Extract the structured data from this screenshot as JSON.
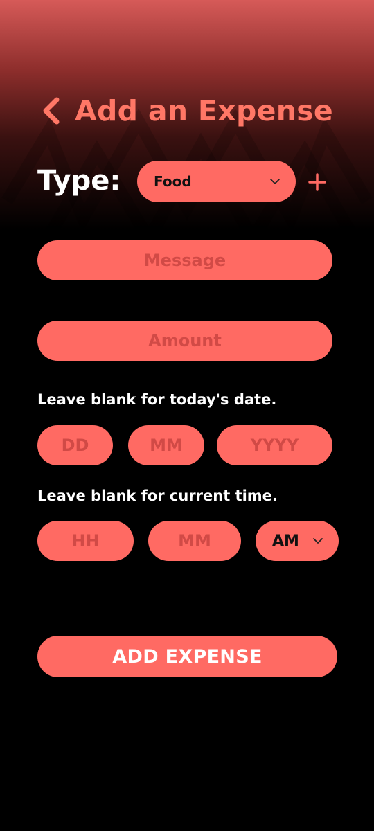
{
  "header": {
    "title": "Add an Expense",
    "back_icon": "chevron-left-icon"
  },
  "type_row": {
    "label": "Type:",
    "selected": "Food",
    "dropdown_icon": "chevron-down-icon",
    "add_icon": "plus-icon"
  },
  "fields": {
    "message_placeholder": "Message",
    "amount_placeholder": "Amount"
  },
  "date": {
    "hint": "Leave blank for today's date.",
    "day_placeholder": "DD",
    "month_placeholder": "MM",
    "year_placeholder": "YYYY"
  },
  "time": {
    "hint": "Leave blank for current time.",
    "hour_placeholder": "HH",
    "minute_placeholder": "MM",
    "period_selected": "AM"
  },
  "submit": {
    "label": "ADD EXPENSE"
  },
  "colors": {
    "accent": "#ff6a63",
    "title": "#ff7766",
    "placeholder": "#d14a46",
    "background": "#000000"
  }
}
